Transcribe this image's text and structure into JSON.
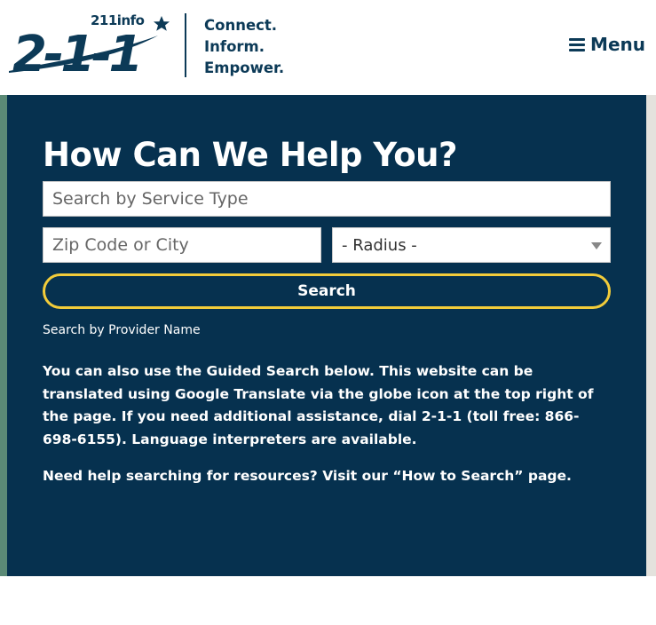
{
  "header": {
    "brand_small": "211info",
    "brand_number": "2-1-1",
    "tagline": [
      "Connect.",
      "Inform.",
      "Empower."
    ],
    "menu_label": "Menu"
  },
  "search": {
    "title": "How Can We Help You?",
    "service_placeholder": "Search by Service Type",
    "zip_placeholder": "Zip Code or City",
    "radius_value": "- Radius -",
    "button_label": "Search",
    "provider_link": "Search by Provider Name"
  },
  "info": {
    "paragraph": "You can also use the Guided Search below. This website can be translated using Google Translate via the globe icon at the top right of the page. If you need additional assistance, dial 2-1-1 (toll free: 866-698-6155). Language interpreters are available.",
    "help_prefix": "Need help searching for resources? Visit our ",
    "help_link": "“How to Search”",
    "help_suffix": " page."
  },
  "colors": {
    "navy": "#06314f",
    "brand": "#0c3a57",
    "accent_yellow": "#f2cc3a",
    "green_strip": "#5b8a76"
  },
  "icons": [
    "star-icon",
    "hamburger-icon",
    "caret-down-icon"
  ]
}
